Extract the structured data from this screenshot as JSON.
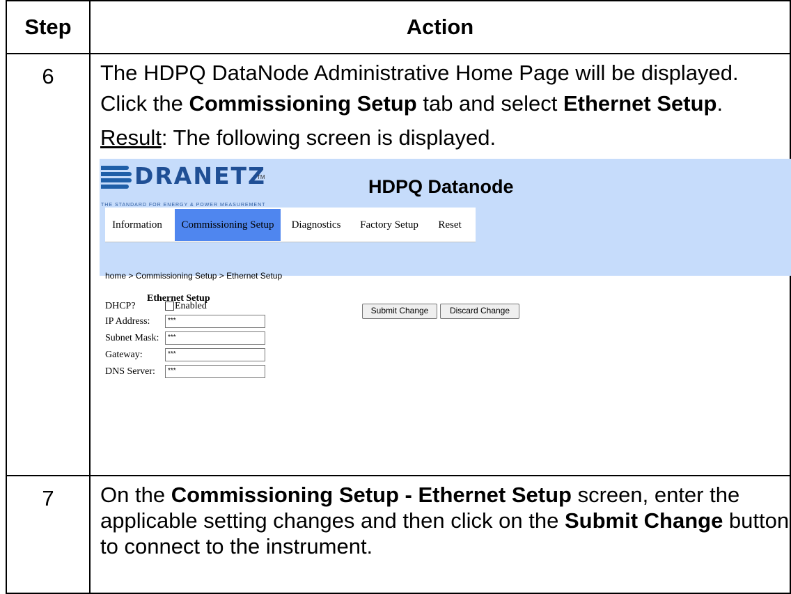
{
  "table": {
    "header": {
      "step": "Step",
      "action": "Action"
    },
    "row6": {
      "step": "6",
      "line1": "The HDPQ DataNode Administrative Home Page will be displayed.",
      "line2_prefix": "Click the ",
      "line2_bold1": "Commissioning Setup",
      "line2_mid": " tab and select ",
      "line2_bold2": "Ethernet Setup",
      "line2_suffix": ".",
      "result_label": "Result",
      "result_text": ": The following screen is displayed."
    },
    "row7": {
      "step": "7",
      "prefix": "On the ",
      "bold1": "Commissioning Setup - Ethernet Setup",
      "mid": " screen, enter the applicable setting changes and then click on the ",
      "bold2": "Submit Change",
      "suffix": " button to connect to the instrument."
    }
  },
  "screenshot": {
    "logo": {
      "word": "DRANETZ",
      "tm": "TM",
      "tagline": "THE STANDARD FOR ENERGY & POWER MEASUREMENT"
    },
    "app_title": "HDPQ Datanode",
    "tabs": [
      {
        "label": "Information"
      },
      {
        "label": "Commissioning Setup"
      },
      {
        "label": "Diagnostics"
      },
      {
        "label": "Factory Setup"
      },
      {
        "label": "Reset"
      }
    ],
    "active_tab": "Commissioning Setup",
    "breadcrumb": "home > Commissioning Setup > Ethernet Setup",
    "form": {
      "title": "Ethernet Setup",
      "dhcp_label": "DHCP?",
      "dhcp_option": "Enabled",
      "dhcp_checked": false,
      "fields": [
        {
          "label": "IP Address:",
          "value": "***"
        },
        {
          "label": "Subnet Mask:",
          "value": "***"
        },
        {
          "label": "Gateway:",
          "value": "***"
        },
        {
          "label": "DNS Server:",
          "value": "***"
        }
      ],
      "submit_label": "Submit Change",
      "discard_label": "Discard Change"
    },
    "colors": {
      "banner": "#c6dcfb",
      "active_tab": "#4f86ef",
      "logo_blue": "#1f4f95"
    }
  }
}
